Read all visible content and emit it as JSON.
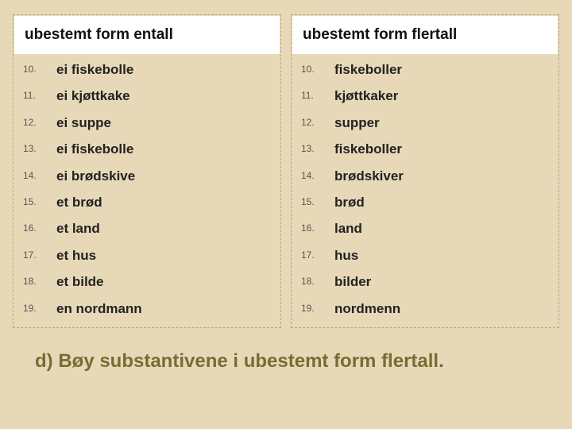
{
  "left": {
    "header": "ubestemt form entall",
    "items": [
      {
        "n": "10.",
        "t": "ei fiskebolle"
      },
      {
        "n": "11.",
        "t": "ei kjøttkake"
      },
      {
        "n": "12.",
        "t": "ei suppe"
      },
      {
        "n": "13.",
        "t": "ei fiskebolle"
      },
      {
        "n": "14.",
        "t": "ei brødskive"
      },
      {
        "n": "15.",
        "t": "et brød"
      },
      {
        "n": "16.",
        "t": "et land"
      },
      {
        "n": "17.",
        "t": "et hus"
      },
      {
        "n": "18.",
        "t": "et bilde"
      },
      {
        "n": "19.",
        "t": "en nordmann"
      }
    ]
  },
  "right": {
    "header": "ubestemt form flertall",
    "items": [
      {
        "n": "10.",
        "t": "fiskeboller"
      },
      {
        "n": "11.",
        "t": "kjøttkaker"
      },
      {
        "n": "12.",
        "t": "supper"
      },
      {
        "n": "13.",
        "t": "fiskeboller"
      },
      {
        "n": "14.",
        "t": "brødskiver"
      },
      {
        "n": "15.",
        "t": "brød"
      },
      {
        "n": "16.",
        "t": "land"
      },
      {
        "n": "17.",
        "t": "hus"
      },
      {
        "n": "18.",
        "t": "bilder"
      },
      {
        "n": "19.",
        "t": "nordmenn"
      }
    ]
  },
  "footer": "d) Bøy substantivene i ubestemt form flertall."
}
